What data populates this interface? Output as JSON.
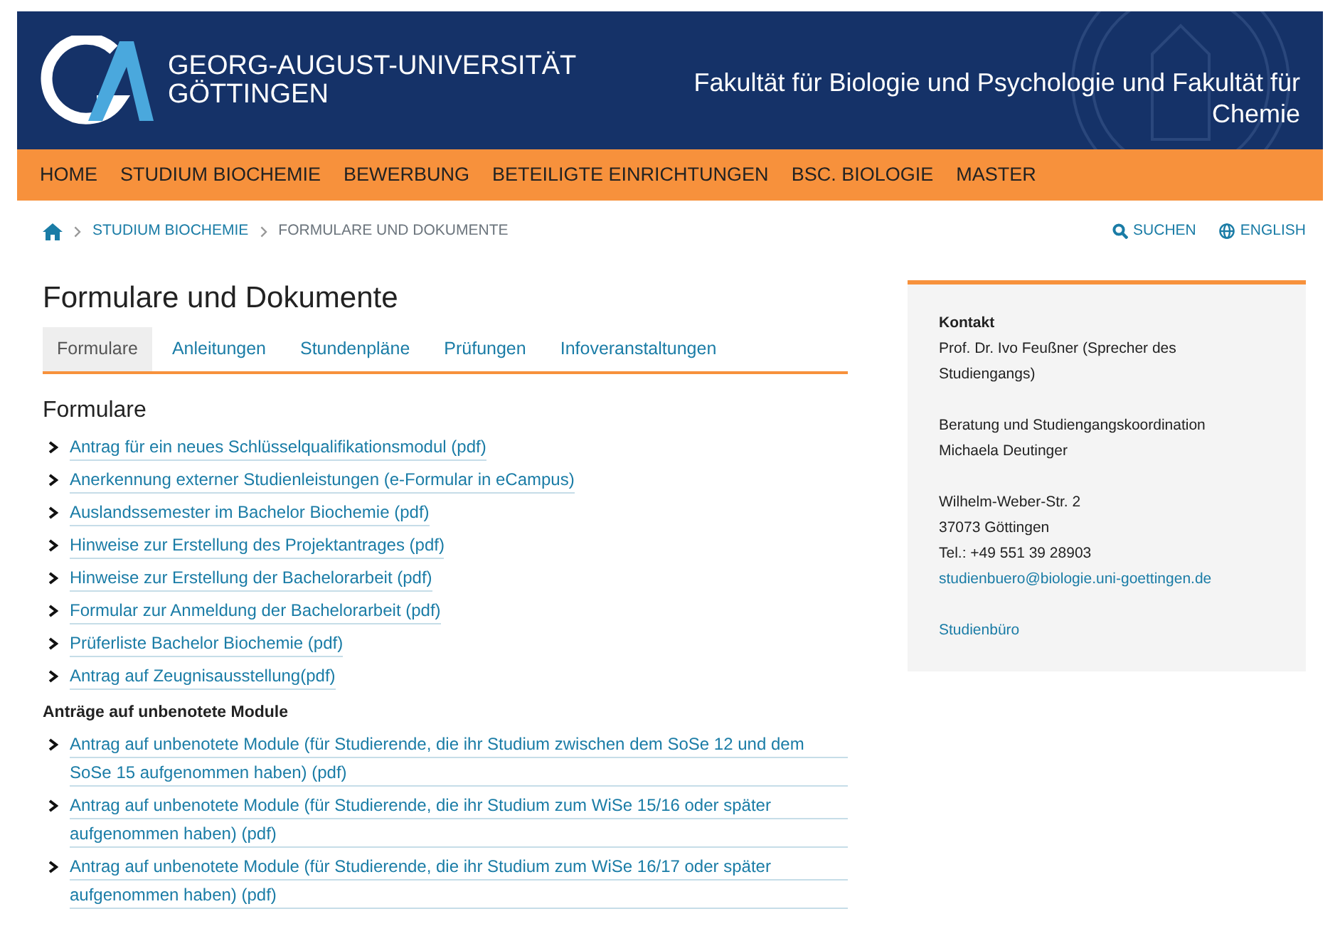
{
  "header": {
    "logo_lines": [
      "GEORG-AUGUST-UNIVERSITÄT",
      "GÖTTINGEN"
    ],
    "faculty_lines": [
      "Fakultät für Biologie und Psychologie und Fakultät für",
      "Chemie"
    ]
  },
  "nav": [
    "HOME",
    "STUDIUM BIOCHEMIE",
    "BEWERBUNG",
    "BETEILIGTE EINRICHTUNGEN",
    "BSC. BIOLOGIE",
    "MASTER"
  ],
  "breadcrumb": [
    {
      "kind": "home"
    },
    {
      "kind": "link",
      "label": "STUDIUM BIOCHEMIE"
    },
    {
      "kind": "current",
      "label": "FORMULARE UND DOKUMENTE"
    }
  ],
  "tools": [
    {
      "kind": "search",
      "label": "SUCHEN"
    },
    {
      "kind": "language",
      "label": "ENGLISH"
    }
  ],
  "page_title": "Formulare und Dokumente",
  "tabs": [
    {
      "label": "Formulare",
      "selected": true
    },
    {
      "label": "Anleitungen",
      "selected": false
    },
    {
      "label": "Stundenpläne",
      "selected": false
    },
    {
      "label": "Prüfungen",
      "selected": false
    },
    {
      "label": "Infoveranstaltungen",
      "selected": false
    }
  ],
  "sections": [
    {
      "kind": "major",
      "heading": "Formulare",
      "links": [
        "Antrag für ein neues Schlüsselqualifikationsmodul (pdf)",
        "Anerkennung externer Studienleistungen (e-Formular in eCampus)",
        "Auslandssemester im Bachelor Biochemie (pdf)",
        "Hinweise zur Erstellung des Projektantrages (pdf)",
        "Hinweise zur Erstellung der Bachelorarbeit (pdf)",
        "Formular zur Anmeldung der Bachelorarbeit (pdf)",
        "Prüferliste Bachelor Biochemie (pdf)",
        "Antrag auf Zeugnisausstellung(pdf)"
      ]
    },
    {
      "kind": "minor",
      "heading": "Anträge auf unbenotete Module",
      "links": [
        "Antrag auf unbenotete Module (für Studierende, die ihr Studium zwischen dem SoSe 12 und dem SoSe 15 aufgenommen haben) (pdf)",
        "Antrag auf unbenotete Module (für Studierende, die ihr Studium zum WiSe 15/16 oder später aufgenommen haben) (pdf)",
        "Antrag auf unbenotete Module (für Studierende, die ihr Studium zum WiSe 16/17 oder später aufgenommen haben) (pdf)"
      ]
    }
  ],
  "contact": {
    "heading": "Kontakt",
    "blocks": [
      [
        {
          "kind": "text",
          "text": "Prof. Dr. Ivo Feußner (Sprecher des Studiengangs)"
        }
      ],
      [
        {
          "kind": "text",
          "text": "Beratung und Studiengangskoordination"
        },
        {
          "kind": "text",
          "text": "Michaela Deutinger"
        }
      ],
      [
        {
          "kind": "text",
          "text": "Wilhelm-Weber-Str. 2"
        },
        {
          "kind": "text",
          "text": "37073 Göttingen"
        },
        {
          "kind": "text",
          "text": "Tel.: +49 551 39 28903"
        },
        {
          "kind": "link",
          "text": "studienbuero@biologie.uni-goettingen.de"
        }
      ],
      [
        {
          "kind": "link",
          "text": "Studienbüro"
        }
      ]
    ]
  }
}
